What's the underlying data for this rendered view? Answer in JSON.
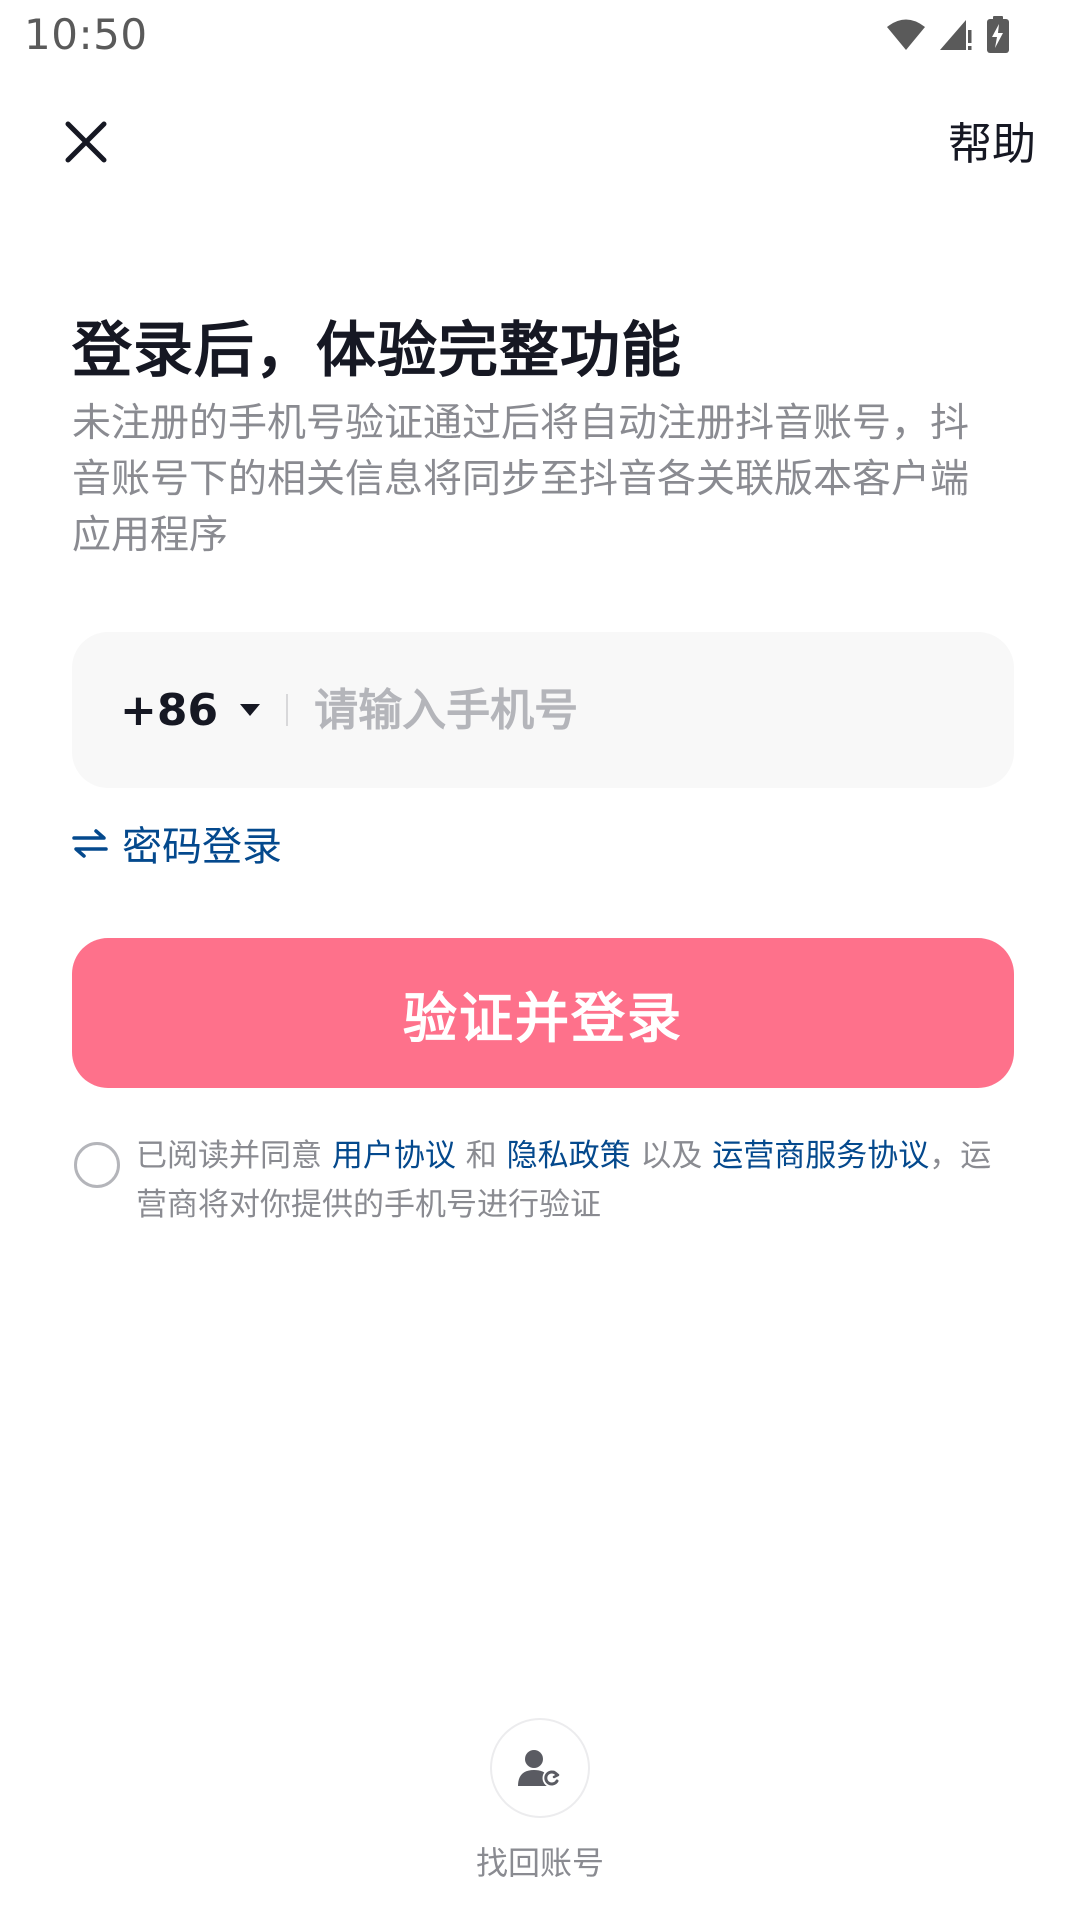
{
  "status_bar": {
    "time": "10:50",
    "icons": [
      "wifi-icon",
      "signal-icon",
      "battery-charging-icon"
    ]
  },
  "nav": {
    "close_icon": "close-icon",
    "help_label": "帮助"
  },
  "header": {
    "title": "登录后，体验完整功能",
    "subtitle": "未注册的手机号验证通过后将自动注册抖音账号，抖音账号下的相关信息将同步至抖音各关联版本客户端应用程序"
  },
  "phone_input": {
    "country_code": "+86",
    "placeholder": "请输入手机号",
    "value": ""
  },
  "password_login": {
    "icon": "swap-icon",
    "label": "密码登录"
  },
  "submit": {
    "label": "验证并登录"
  },
  "agreement": {
    "checked": false,
    "prefix": "已阅读并同意 ",
    "user_agreement": "用户协议",
    "and": " 和 ",
    "privacy_policy": "隐私政策",
    "and_also": " 以及 ",
    "carrier_agreement": "运营商服务协议",
    "suffix": "，运营商将对你提供的手机号进行验证"
  },
  "recover_account": {
    "icon": "user-refresh-icon",
    "label": "找回账号"
  },
  "colors": {
    "accent": "#fe718b",
    "link": "#04498d",
    "text_primary": "#161823",
    "text_secondary": "#8a8b91",
    "input_bg": "#f8f8f8"
  }
}
